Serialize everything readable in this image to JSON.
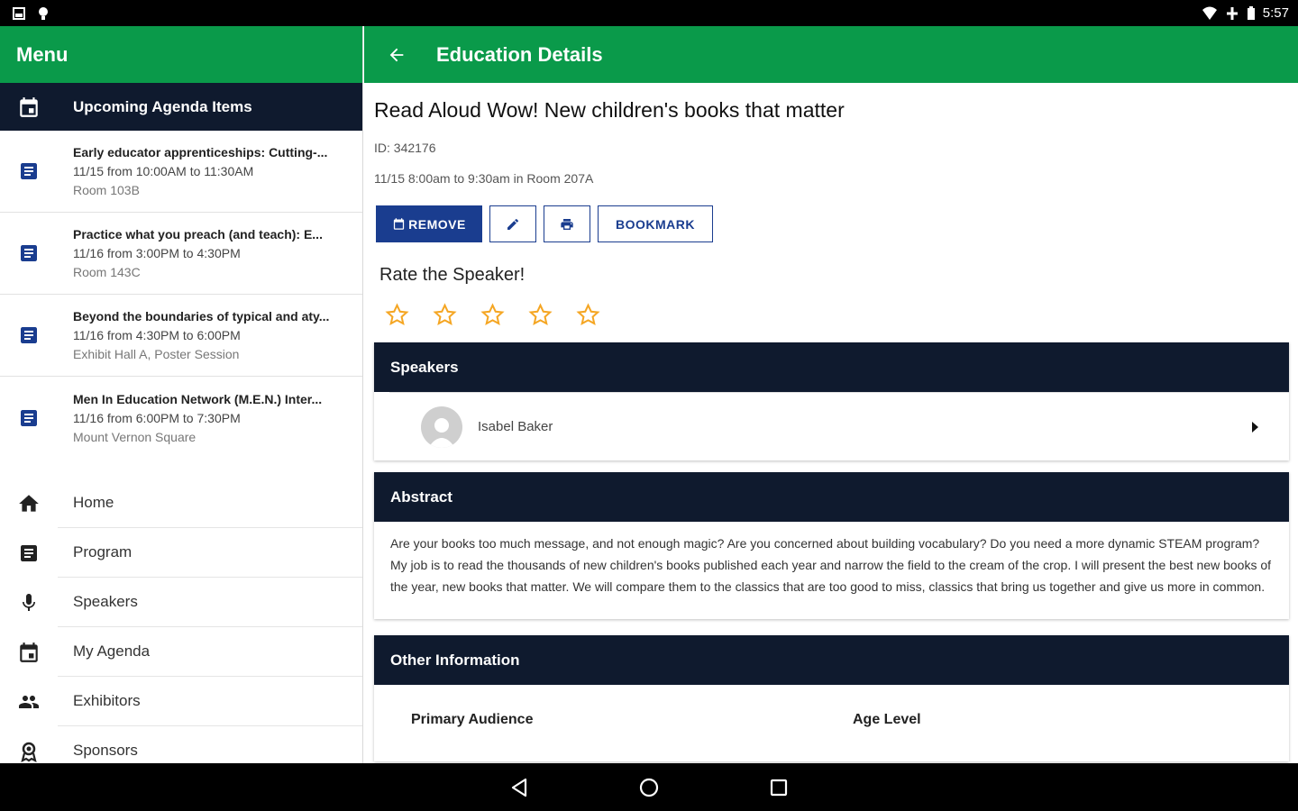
{
  "status_bar": {
    "time": "5:57"
  },
  "drawer": {
    "title": "Menu",
    "upcoming_header": "Upcoming Agenda Items",
    "agenda_items": [
      {
        "title": "Early educator apprenticeships: Cutting-...",
        "time": "11/15 from 10:00AM to 11:30AM",
        "location": "Room 103B"
      },
      {
        "title": "Practice what you preach (and teach): E...",
        "time": "11/16 from 3:00PM to 4:30PM",
        "location": "Room 143C"
      },
      {
        "title": "Beyond the boundaries of typical and aty...",
        "time": "11/16 from 4:30PM to 6:00PM",
        "location": "Exhibit Hall A, Poster Session"
      },
      {
        "title": "Men In Education Network (M.E.N.) Inter...",
        "time": "11/16 from 6:00PM to 7:30PM",
        "location": "Mount Vernon Square"
      }
    ],
    "nav": [
      {
        "label": "Home",
        "icon": "home-icon"
      },
      {
        "label": "Program",
        "icon": "program-icon"
      },
      {
        "label": "Speakers",
        "icon": "microphone-icon"
      },
      {
        "label": "My Agenda",
        "icon": "calendar-icon"
      },
      {
        "label": "Exhibitors",
        "icon": "people-icon"
      },
      {
        "label": "Sponsors",
        "icon": "award-icon"
      }
    ]
  },
  "main": {
    "appbar_title": "Education Details",
    "session_title": "Read Aloud Wow! New children's books that matter",
    "session_id": "ID: 342176",
    "session_time": "11/15 8:00am to 9:30am in Room 207A",
    "buttons": {
      "remove": "REMOVE",
      "bookmark": "BOOKMARK"
    },
    "rate_title": "Rate the Speaker!",
    "rating": {
      "value": 0,
      "max": 5
    },
    "speakers": {
      "header": "Speakers",
      "items": [
        {
          "name": "Isabel Baker"
        }
      ]
    },
    "abstract": {
      "header": "Abstract",
      "text": "Are your books too much message, and not enough magic? Are you concerned about building vocabulary? Do you need a more dynamic STEAM program? My job is to read the thousands of new children's books published each year and narrow the field to the cream of the crop. I will present the best new books of the year, new books that matter. We will compare them to the classics that are too good to miss, classics that bring us together and give us more in common."
    },
    "other_info": {
      "header": "Other Information",
      "col1": "Primary Audience",
      "col2": "Age Level"
    }
  },
  "colors": {
    "green": "#0a9a4a",
    "navy": "#0f1a2e",
    "button_blue": "#1a3d8f",
    "star": "#f5a623"
  }
}
